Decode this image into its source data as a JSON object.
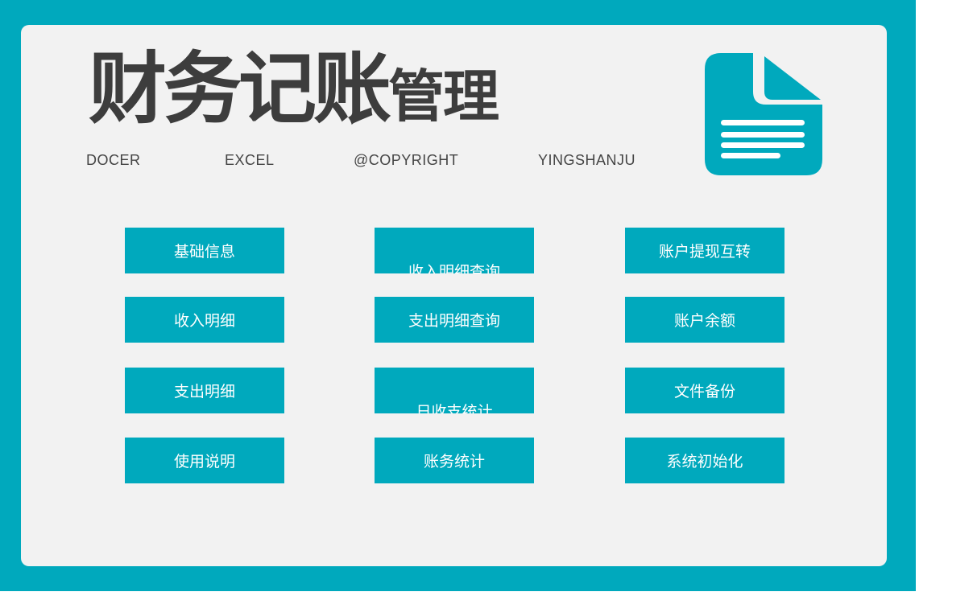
{
  "header": {
    "title_main": "财务记账",
    "title_suffix": "管理",
    "subtitle": [
      "DOCER",
      "EXCEL",
      "@COPYRIGHT",
      "YINGSHANJU"
    ]
  },
  "icon": {
    "name": "document-icon",
    "color": "#00a9bd"
  },
  "colors": {
    "frame": "#00a9bd",
    "panel": "#f2f2f2",
    "button": "#00a9bd",
    "button_text": "#ffffff",
    "title": "#3d3d3d"
  },
  "buttons": {
    "basic_info": "基础信息",
    "income_query": "收入明细查询",
    "account_transfer": "账户提现互转",
    "income_detail": "收入明细",
    "expense_query": "支出明细查询",
    "account_balance": "账户余额",
    "expense_detail": "支出明细",
    "daily_stats": "日收支统计",
    "file_backup": "文件备份",
    "instructions": "使用说明",
    "finance_stats": "账务统计",
    "system_init": "系统初始化"
  }
}
